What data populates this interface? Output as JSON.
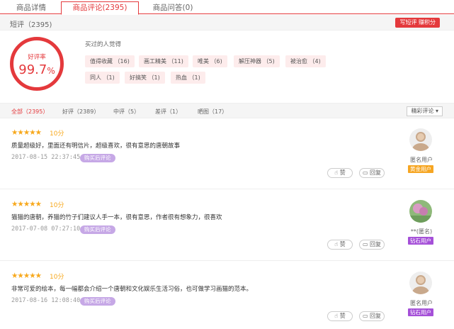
{
  "tabs": [
    {
      "label": "商品详情"
    },
    {
      "label": "商品评论(2395)"
    },
    {
      "label": "商品问答(0)"
    }
  ],
  "short_reviews": {
    "title": "短评（2395)",
    "write_button": "写短评 赚积分"
  },
  "rating": {
    "label": "好评率",
    "value": "99.7",
    "unit": "%"
  },
  "tags_section": {
    "title": "买过的人觉得",
    "tags": [
      {
        "label": "值得收藏 （16)"
      },
      {
        "label": "画工精美 （11)"
      },
      {
        "label": "唯美 （6)"
      },
      {
        "label": "解压神器 （5)"
      },
      {
        "label": "被治愈 （4)"
      },
      {
        "label": "同人 （1)"
      },
      {
        "label": "好搞笑 （1)"
      },
      {
        "label": "热血 （1)"
      }
    ]
  },
  "filters": {
    "items": [
      {
        "label": "全部（2395）"
      },
      {
        "label": "好评（2389）"
      },
      {
        "label": "中评（5）"
      },
      {
        "label": "差评（1）"
      },
      {
        "label": "晒图（17）"
      }
    ],
    "sort_label": "精彩评论 ▾"
  },
  "comments": [
    {
      "stars": "★★★★★",
      "score": "10分",
      "text": "质量超级好，里面还有明信片，超级喜欢，很有意思的唐朝故事",
      "date": "2017-08-15 22:37:45",
      "badge": "购买后评论",
      "user": "匿名用户",
      "level": "黄金用户",
      "level_color": "#f6a623",
      "like": "赞",
      "reply": "回复"
    },
    {
      "stars": "★★★★★",
      "score": "10分",
      "text": "猫猫的唐朝，养猫的竹子们建议人手一本，很有意思，作者很有想象力，很喜欢",
      "date": "2017-07-08 07:27:10",
      "badge": "购买后评论",
      "user": "**(匿名)",
      "level": "钻石用户",
      "level_color": "#a550d8",
      "like": "赞",
      "reply": "回复"
    },
    {
      "stars": "★★★★★",
      "score": "10分",
      "text": "非常可爱的绘本，每一幅都会介绍一个唐朝和文化娱乐生活习俗，也可做学习画猫的范本。",
      "date": "2017-08-16 12:08:40",
      "badge": "购买后评论",
      "user": "匿名用户",
      "level": "钻石用户",
      "level_color": "#a550d8",
      "like": "赞",
      "reply": "回复"
    }
  ]
}
